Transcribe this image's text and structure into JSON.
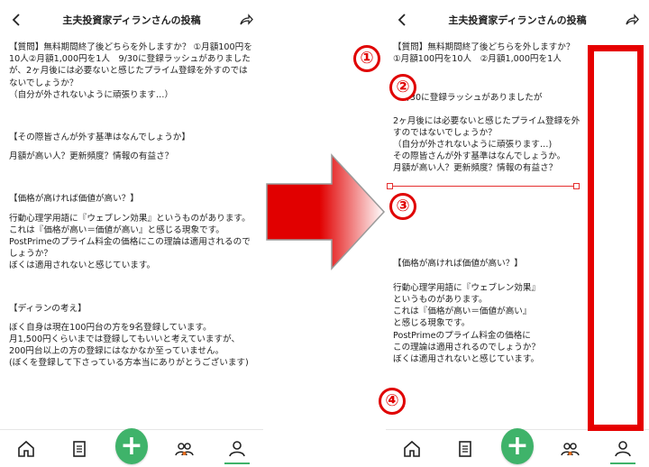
{
  "header": {
    "title": "主夫投資家ディランさんの投稿"
  },
  "left": {
    "paragraphs": [
      "【質問】無料期間終了後どちらを外しますか？ ①月額100円を10人②月額1,000円を1人　9/30に登録ラッシュがありましたが、2ヶ月後には必要ないと感じたプライム登録を外すのではないでしょうか？\n（自分が外されないように頑張ります…）",
      "【その際皆さんが外す基準はなんでしょうか】",
      "月額が高い人？更新頻度？情報の有益さ？",
      "【価格が高ければ価値が高い？】",
      "行動心理学用語に『ウェブレン効果』というものがあります。\nこれは『価格が高い＝価値が高い』と感じる現象です。\nPostPrimeのプライム料金の価格にこの理論は適用されるのでしょうか？\nぼくは適用されないと感じています。",
      "【ディランの考え】",
      "ぼく自身は現在100円台の方を9名登録しています。\n月1,500円くらいまでは登録してもいいと考えていますが、200円台以上の方の登録にはなかなか至っていません。\n(ぼくを登録して下さっている方本当にありがとうございます)"
    ]
  },
  "right": {
    "paragraphs": [
      "【質問】無料期間終了後どちらを外しますか？\n①月額100円を10人　②月額1,000円を1人",
      "【9/30に登録ラッシュがありましたが",
      "2ヶ月後には必要ないと感じたプライム登録を外すのではないでしょうか？\n（自分が外されないように頑張ります…)\nその際皆さんが外す基準はなんでしょうか。\n月額が高い人？更新頻度？情報の有益さ？",
      "【価格が高ければ価値が高い？】",
      "行動心理学用語に『ウェブレン効果』\nというものがあります。\nこれは『価格が高い＝価値が高い』\nと感じる現象です。\nPostPrimeのプライム料金の価格に\nこの理論は適用されるのでしょうか？\nぼくは適用されないと感じています。"
    ]
  },
  "markers": {
    "m1": "①",
    "m2": "②",
    "m3": "③",
    "m4": "④"
  },
  "nav": {
    "plus_label": "+"
  },
  "colors": {
    "accent_green": "#3fb36a",
    "annotation_red": "#e60000"
  },
  "icons": [
    "back-arrow-icon",
    "share-icon",
    "home-icon",
    "document-icon",
    "plus-icon",
    "people-icon",
    "user-icon"
  ]
}
